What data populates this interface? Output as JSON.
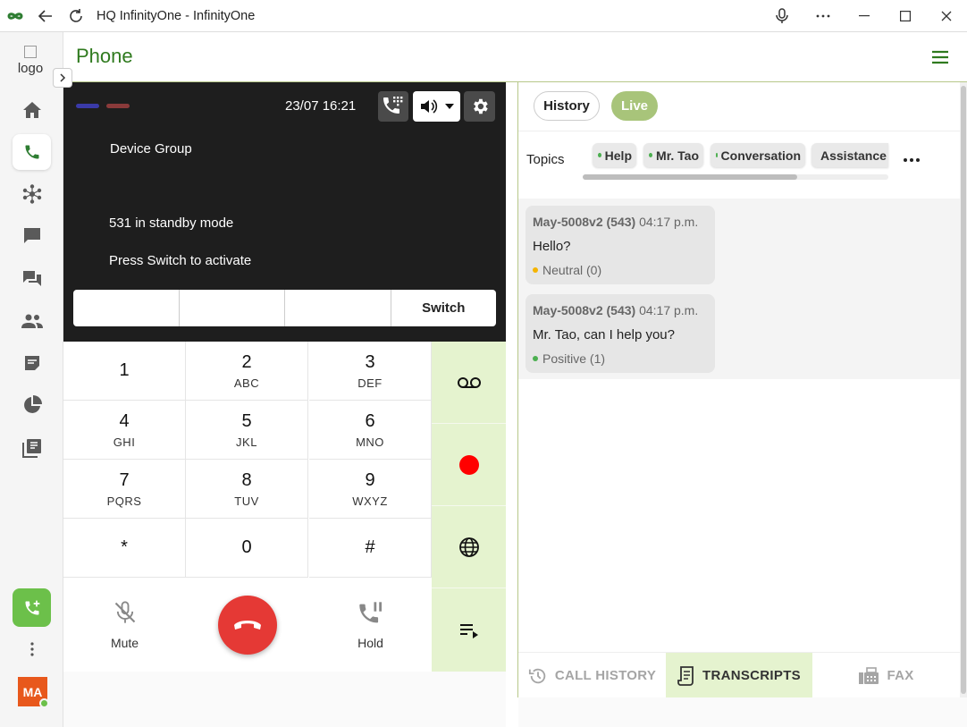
{
  "window": {
    "title": "HQ InfinityOne - InfinityOne"
  },
  "rail": {
    "logo_alt": "logo",
    "avatar_initials": "MA",
    "items": [
      {
        "name": "home-icon"
      },
      {
        "name": "phone-icon"
      },
      {
        "name": "hub-icon"
      },
      {
        "name": "chat-icon"
      },
      {
        "name": "forum-icon"
      },
      {
        "name": "contacts-icon"
      },
      {
        "name": "notes-icon"
      },
      {
        "name": "reports-icon"
      },
      {
        "name": "library-icon"
      }
    ]
  },
  "header": {
    "title": "Phone"
  },
  "device": {
    "datetime": "23/07  16:21",
    "group": "Device Group",
    "standby": "531 in standby mode",
    "hint": "Press Switch to activate",
    "switch_label": "Switch"
  },
  "keypad": [
    {
      "digit": "1",
      "letters": ""
    },
    {
      "digit": "2",
      "letters": "ABC"
    },
    {
      "digit": "3",
      "letters": "DEF"
    },
    {
      "digit": "4",
      "letters": "GHI"
    },
    {
      "digit": "5",
      "letters": "JKL"
    },
    {
      "digit": "6",
      "letters": "MNO"
    },
    {
      "digit": "7",
      "letters": "PQRS"
    },
    {
      "digit": "8",
      "letters": "TUV"
    },
    {
      "digit": "9",
      "letters": "WXYZ"
    },
    {
      "digit": "*",
      "letters": ""
    },
    {
      "digit": "0",
      "letters": ""
    },
    {
      "digit": "#",
      "letters": ""
    }
  ],
  "call_controls": {
    "mute": "Mute",
    "hold": "Hold"
  },
  "transcripts": {
    "toggle": {
      "history": "History",
      "live": "Live"
    },
    "topics_label": "Topics",
    "topics": [
      "Help",
      "Mr. Tao",
      "Conversation",
      "Assistance"
    ],
    "messages": [
      {
        "speaker": "May-5008v2 (543)",
        "time": "04:17 p.m.",
        "text": "Hello?",
        "sentiment": "Neutral (0)",
        "sentiment_color": "#f5b400"
      },
      {
        "speaker": "May-5008v2 (543)",
        "time": "04:17 p.m.",
        "text": "Mr. Tao, can I help you?",
        "sentiment": "Positive (1)",
        "sentiment_color": "#4caf50"
      }
    ],
    "tabs": {
      "call_history": "CALL HISTORY",
      "transcripts": "TRANSCRIPTS",
      "fax": "FAX"
    }
  },
  "colors": {
    "brand_green": "#2f7a1e",
    "accent_green": "#6cc04a",
    "action_bg": "#e5f3cf",
    "record_red": "#ff0000",
    "hangup_red": "#e53935"
  }
}
